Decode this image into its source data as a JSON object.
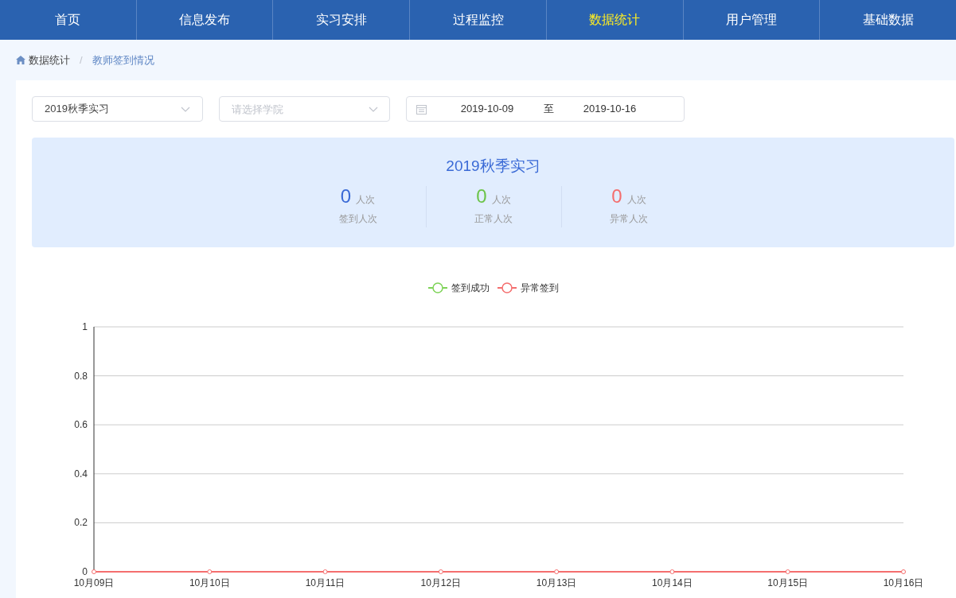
{
  "nav": [
    {
      "label": "首页",
      "selected": false
    },
    {
      "label": "信息发布",
      "selected": false
    },
    {
      "label": "实习安排",
      "selected": false
    },
    {
      "label": "过程监控",
      "selected": false
    },
    {
      "label": "数据统计",
      "selected": true
    },
    {
      "label": "用户管理",
      "selected": false
    },
    {
      "label": "基础数据",
      "selected": false
    }
  ],
  "breadcrumb": {
    "items": [
      "数据统计",
      "教师签到情况"
    ],
    "separator": "/"
  },
  "filters": {
    "term": {
      "value": "2019秋季实习"
    },
    "college": {
      "placeholder": "请选择学院"
    },
    "date_range": {
      "start": "2019-10-09",
      "separator": "至",
      "end": "2019-10-16"
    }
  },
  "summary": {
    "title": "2019秋季实习",
    "stats": [
      {
        "value": "0",
        "unit": "人次",
        "label": "签到人次",
        "color": "#3a6ad6"
      },
      {
        "value": "0",
        "unit": "人次",
        "label": "正常人次",
        "color": "#6cc44a"
      },
      {
        "value": "0",
        "unit": "人次",
        "label": "异常人次",
        "color": "#f46e6e"
      }
    ]
  },
  "chart_data": {
    "type": "line",
    "categories": [
      "10月09日",
      "10月10日",
      "10月11日",
      "10月12日",
      "10月13日",
      "10月14日",
      "10月15日",
      "10月16日"
    ],
    "series": [
      {
        "name": "签到成功",
        "color": "#7ed357",
        "marker": "circle",
        "values": [
          null,
          null,
          null,
          null,
          null,
          null,
          null,
          null
        ]
      },
      {
        "name": "异常签到",
        "color": "#f46e6e",
        "marker": "circle",
        "values": [
          0,
          0,
          0,
          0,
          0,
          0,
          0,
          0
        ]
      }
    ],
    "ylim": [
      0,
      1
    ],
    "yticks": [
      0,
      0.2,
      0.4,
      0.6,
      0.8,
      1
    ],
    "grid": true,
    "legend": true
  }
}
